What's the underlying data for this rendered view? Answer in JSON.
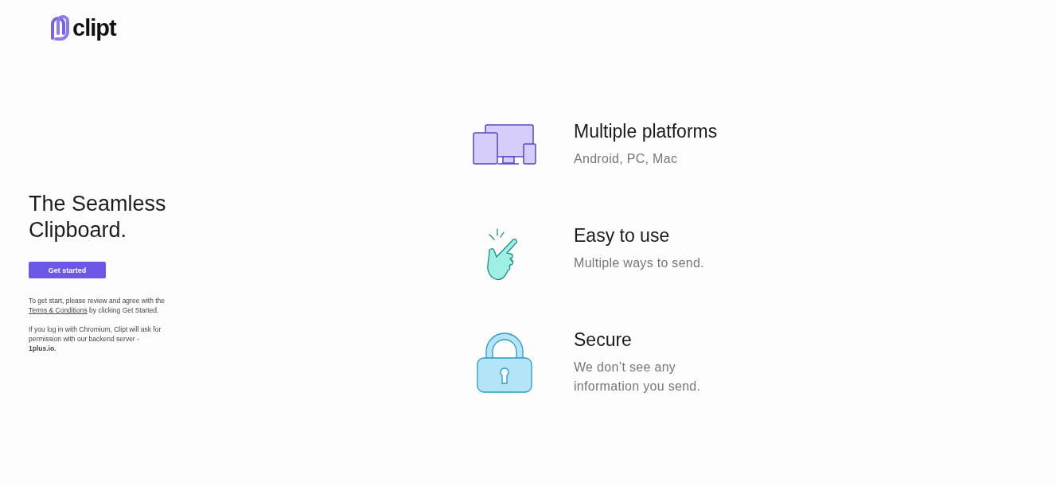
{
  "logo": {
    "text": "clipt"
  },
  "hero": {
    "heading": "The Seamless Clipboard.",
    "button": "Get started",
    "notice": {
      "before": "To get start, please review and agree with the",
      "link": "Terms & Conditions",
      "after": "by clicking Get Started."
    },
    "permission": "If you log in with Chromium, Clipt will ask for permission with our backend server - **1plus.io.**"
  },
  "features": [
    {
      "kind": "devices",
      "title": "Multiple platforms",
      "description": "Android, PC, Mac"
    },
    {
      "kind": "hand",
      "title": "Easy to use",
      "description": "Multiple ways to send."
    },
    {
      "kind": "lock",
      "title": "Secure",
      "description": "We don’t see any information you send."
    }
  ]
}
